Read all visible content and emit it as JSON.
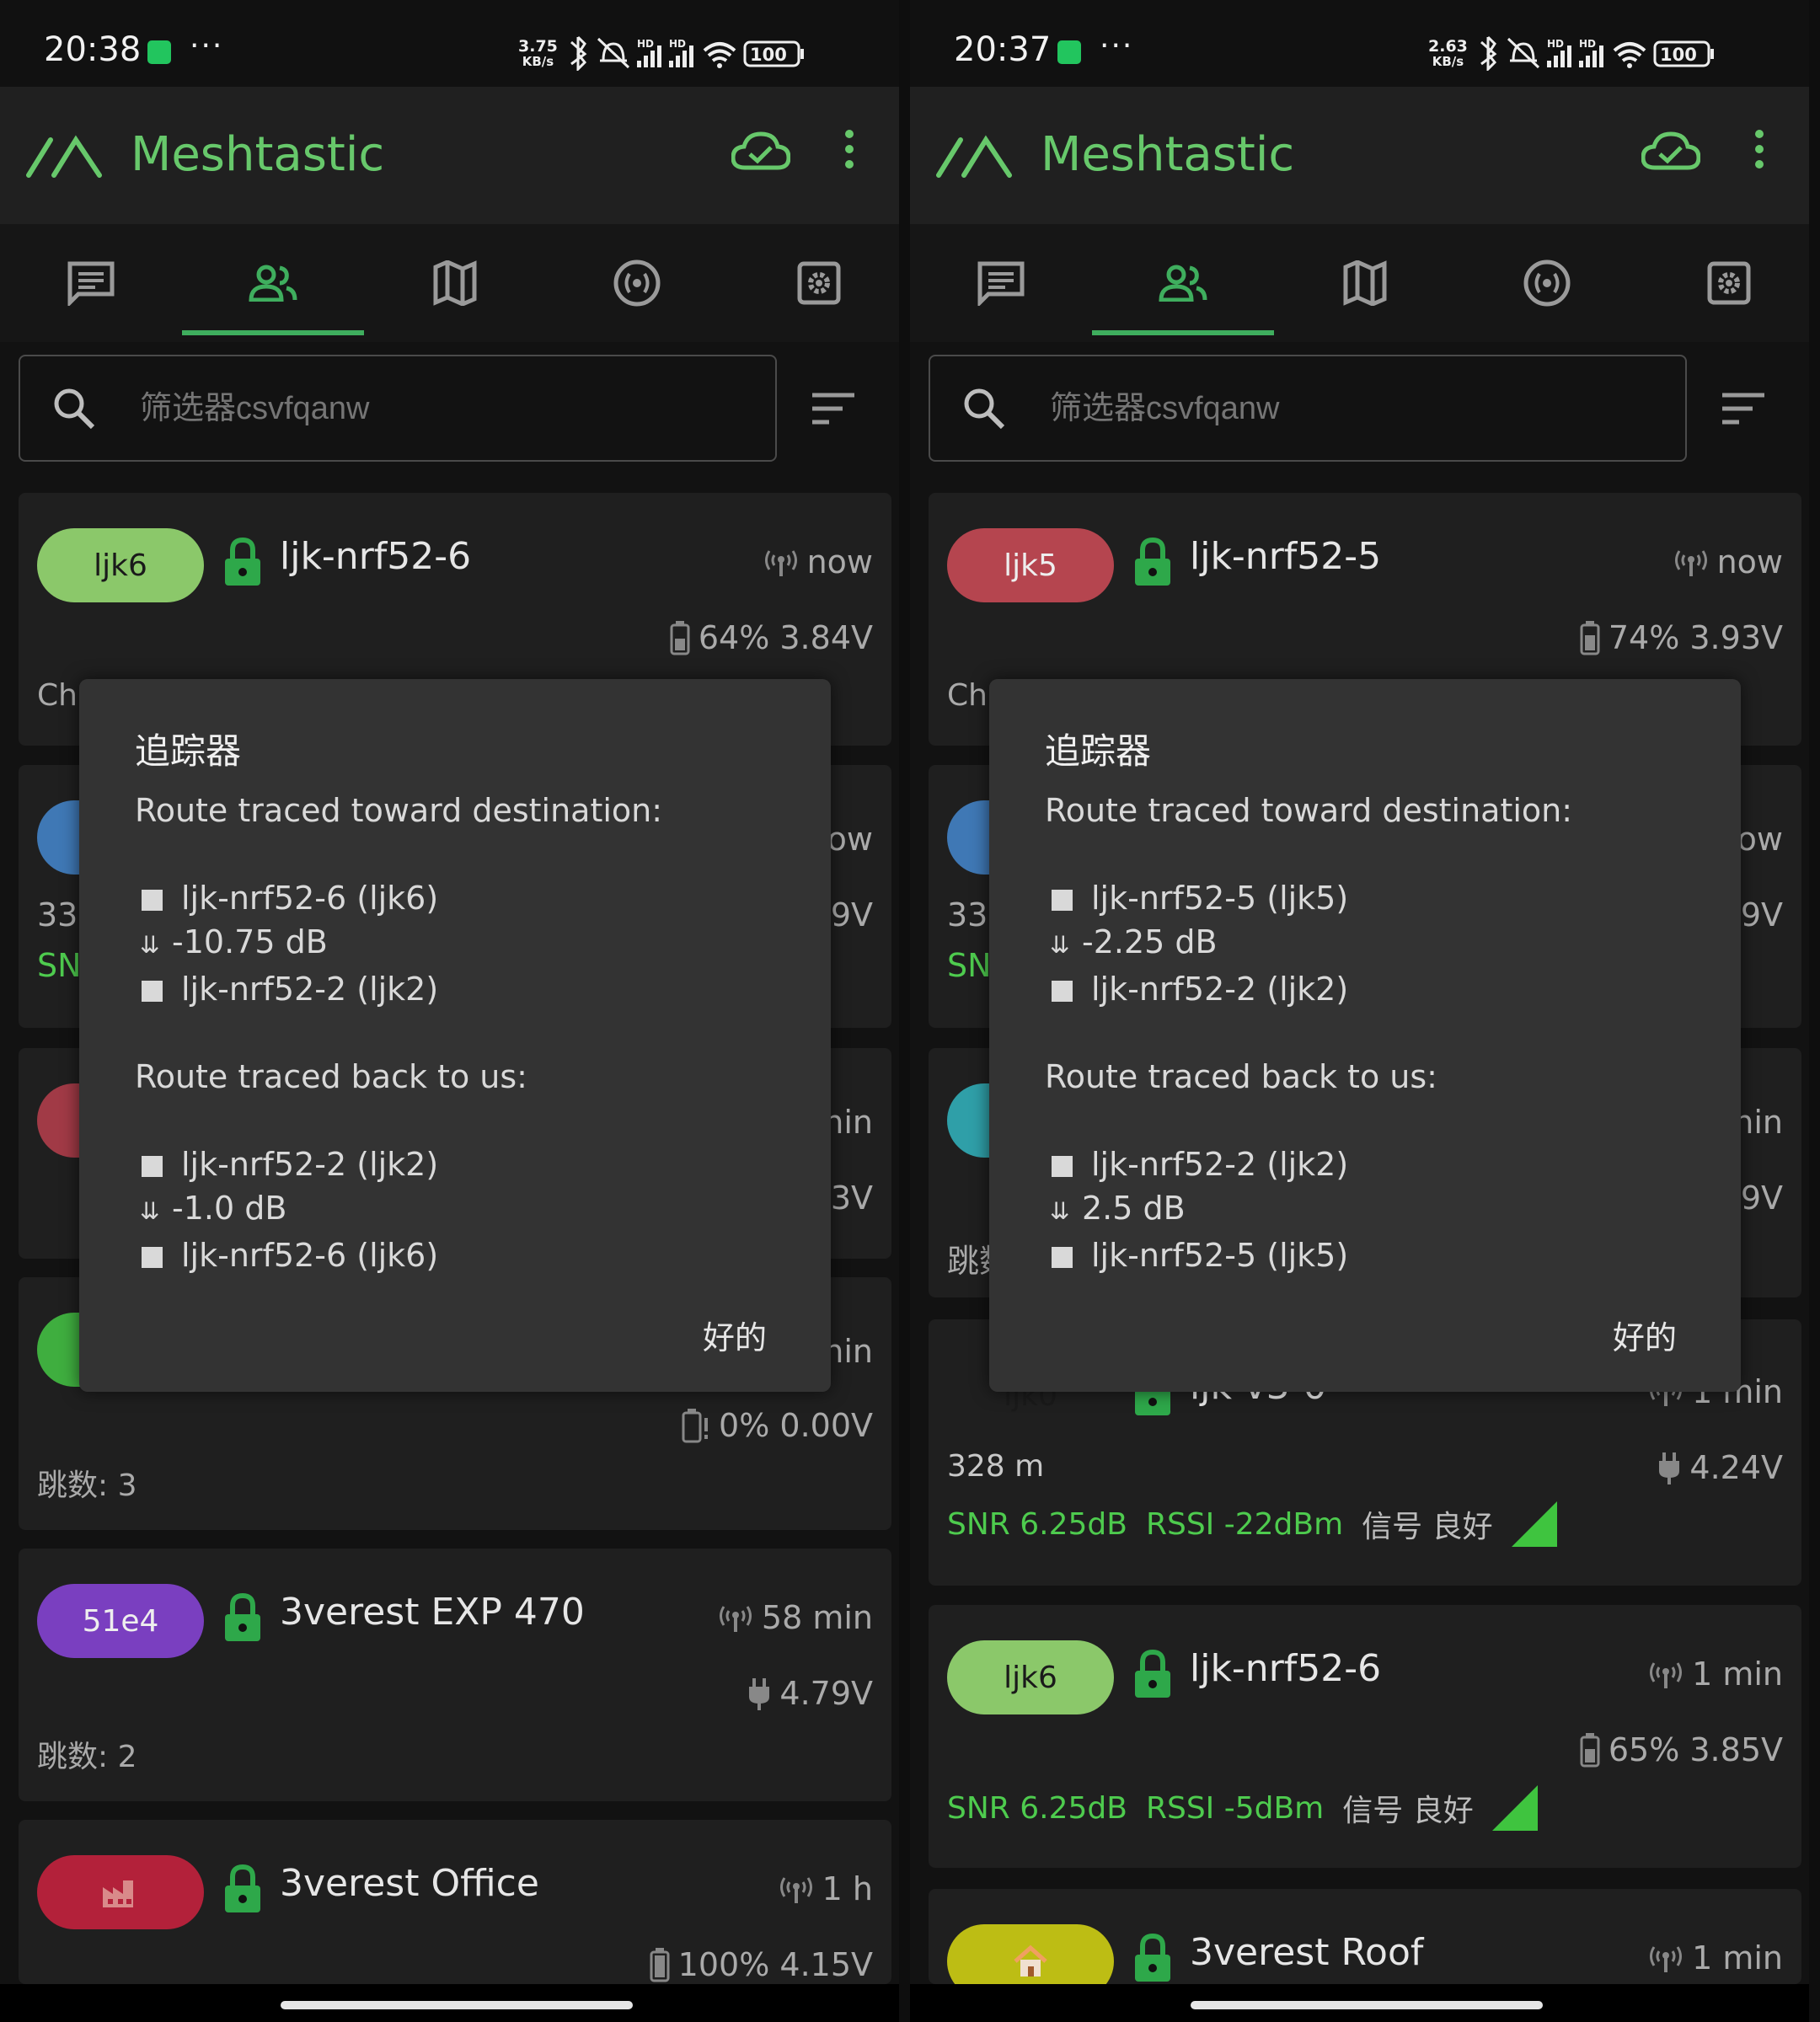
{
  "left": {
    "status": {
      "time": "20:38",
      "speed_top": "3.75",
      "speed_unit": "KB/s",
      "battery": "100"
    },
    "app": {
      "title": "Meshtastic"
    },
    "search": {
      "placeholder": "筛选器csvfqanw"
    },
    "cards": [
      {
        "chip": "ljk6",
        "chip_color": "#8bc86a",
        "name": "ljk-nrf52-6",
        "heard": "now",
        "battery": "64% 3.84V",
        "partial": "Ch"
      },
      {
        "partial_right_1": "ow",
        "partial_right_2": "9V",
        "partial_left_1": "33",
        "partial_left_2": "SN",
        "chip_color": "#3f78b5"
      },
      {
        "partial_right_1": "nin",
        "partial_right_2": "3V",
        "chip_color": "#a13a46"
      },
      {
        "partial_right_1": "nin",
        "battery": "0% 0.00V",
        "hops": "跳数: 3",
        "chip_color": "#3fae3f"
      },
      {
        "chip": "51e4",
        "chip_color": "#7a3fc0",
        "name": "3verest EXP 470",
        "heard": "58 min",
        "voltage": "4.79V",
        "hops": "跳数: 2"
      },
      {
        "chip_color": "#b3213a",
        "name": "3verest Office",
        "heard": "1 h",
        "battery": "100% 4.15V"
      }
    ],
    "dialog": {
      "title": "追踪器",
      "toward_label": "Route traced toward destination:",
      "toward_from": "ljk-nrf52-6 (ljk6)",
      "toward_snr": "-10.75 dB",
      "toward_to": "ljk-nrf52-2 (ljk2)",
      "back_label": "Route traced back to us:",
      "back_from": "ljk-nrf52-2 (ljk2)",
      "back_snr": "-1.0 dB",
      "back_to": "ljk-nrf52-6 (ljk6)",
      "ok": "好的"
    }
  },
  "right": {
    "status": {
      "time": "20:37",
      "speed_top": "2.63",
      "speed_unit": "KB/s",
      "battery": "100"
    },
    "app": {
      "title": "Meshtastic"
    },
    "search": {
      "placeholder": "筛选器csvfqanw"
    },
    "cards": [
      {
        "chip": "ljk5",
        "chip_color": "#b5454f",
        "name": "ljk-nrf52-5",
        "heard": "now",
        "battery": "74% 3.93V",
        "partial": "Ch"
      },
      {
        "partial_right_1": "ow",
        "partial_right_2": "9V",
        "partial_left_1": "33",
        "partial_left_2": "SN",
        "chip_color": "#3f78b5"
      },
      {
        "partial_right_1": "nin",
        "partial_right_2": "9V",
        "partial_left_1": "跳数",
        "chip_color": "#2f9fa8"
      },
      {
        "chip": "ljk0",
        "chip_color": "#2f6fb0",
        "name": "ljk-v3-0",
        "heard": "1 min",
        "distance": "328 m",
        "voltage": "4.24V",
        "snr": "SNR 6.25dB",
        "rssi": "RSSI -22dBm",
        "quality": "信号 良好"
      },
      {
        "chip": "ljk6",
        "chip_color": "#8bc86a",
        "name": "ljk-nrf52-6",
        "heard": "1 min",
        "battery": "65% 3.85V",
        "snr": "SNR 6.25dB",
        "rssi": "RSSI -5dBm",
        "quality": "信号 良好"
      },
      {
        "chip_color": "#bdbd14",
        "name": "3verest Roof",
        "heard": "1 min"
      }
    ],
    "dialog": {
      "title": "追踪器",
      "toward_label": "Route traced toward destination:",
      "toward_from": "ljk-nrf52-5 (ljk5)",
      "toward_snr": "-2.25 dB",
      "toward_to": "ljk-nrf52-2 (ljk2)",
      "back_label": "Route traced back to us:",
      "back_from": "ljk-nrf52-2 (ljk2)",
      "back_snr": "2.5 dB",
      "back_to": "ljk-nrf52-5 (ljk5)",
      "ok": "好的"
    }
  }
}
